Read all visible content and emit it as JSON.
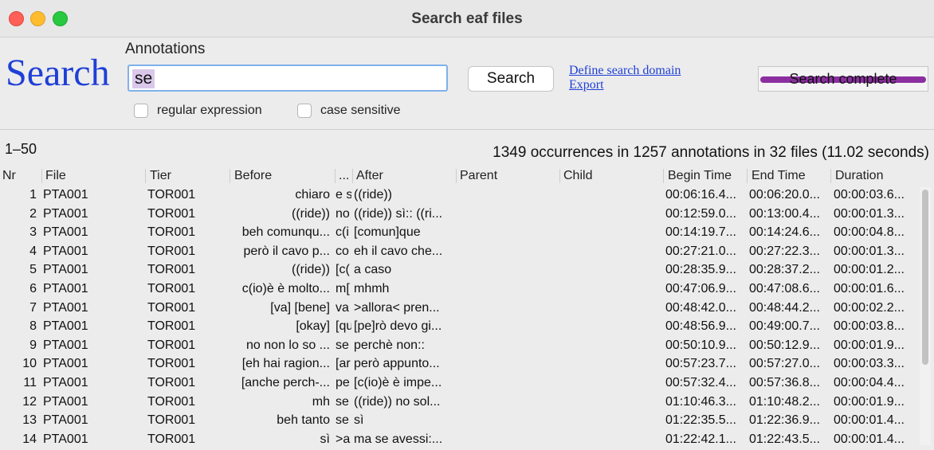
{
  "window": {
    "title": "Search eaf files"
  },
  "search": {
    "big_label": "Search",
    "annotations_label": "Annotations",
    "query": "se",
    "button_label": "Search",
    "define_domain_link": "Define search domain",
    "export_link": "Export",
    "status": "Search complete",
    "progress": 1.0,
    "regex_label": "regular expression",
    "regex_checked": false,
    "case_label": "case sensitive",
    "case_checked": false
  },
  "results": {
    "range": "1–50",
    "summary": "1349 occurrences in 1257 annotations in 32 files (11.02 seconds)",
    "columns": [
      "Nr",
      "File",
      "Tier",
      "Before",
      "...",
      "After",
      "Parent",
      "Child",
      "Begin Time",
      "End Time",
      "Duration"
    ],
    "rows": [
      {
        "nr": "1",
        "file": "PTA001",
        "tier": "TOR001",
        "before": "chiaro",
        "match": "e s",
        "after": "((ride))",
        "begin": "00:06:16.4...",
        "end": "00:06:20.0...",
        "dur": "00:00:03.6..."
      },
      {
        "nr": "2",
        "file": "PTA001",
        "tier": "TOR001",
        "before": "((ride))",
        "match": "no",
        "after": "((ride)) sì:: ((ri...",
        "begin": "00:12:59.0...",
        "end": "00:13:00.4...",
        "dur": "00:00:01.3..."
      },
      {
        "nr": "3",
        "file": "PTA001",
        "tier": "TOR001",
        "before": "beh comunqu...",
        "match": "c(i",
        "after": "[comun]que",
        "begin": "00:14:19.7...",
        "end": "00:14:24.6...",
        "dur": "00:00:04.8..."
      },
      {
        "nr": "4",
        "file": "PTA001",
        "tier": "TOR001",
        "before": "però il cavo p...",
        "match": "co",
        "after": "eh il cavo che...",
        "begin": "00:27:21.0...",
        "end": "00:27:22.3...",
        "dur": "00:00:01.3..."
      },
      {
        "nr": "5",
        "file": "PTA001",
        "tier": "TOR001",
        "before": "((ride))",
        "match": "[c(",
        "after": "a caso",
        "begin": "00:28:35.9...",
        "end": "00:28:37.2...",
        "dur": "00:00:01.2..."
      },
      {
        "nr": "6",
        "file": "PTA001",
        "tier": "TOR001",
        "before": "c(io)è è molto...",
        "match": "m[",
        "after": "mhmh",
        "begin": "00:47:06.9...",
        "end": "00:47:08.6...",
        "dur": "00:00:01.6..."
      },
      {
        "nr": "7",
        "file": "PTA001",
        "tier": "TOR001",
        "before": "[va] [bene]",
        "match": "va",
        "after": ">allora< pren...",
        "begin": "00:48:42.0...",
        "end": "00:48:44.2...",
        "dur": "00:00:02.2..."
      },
      {
        "nr": "8",
        "file": "PTA001",
        "tier": "TOR001",
        "before": "[okay]",
        "match": "[qu",
        "after": "[pe]rò devo gi...",
        "begin": "00:48:56.9...",
        "end": "00:49:00.7...",
        "dur": "00:00:03.8..."
      },
      {
        "nr": "9",
        "file": "PTA001",
        "tier": "TOR001",
        "before": "no non lo so ...",
        "match": "se",
        "after": "perchè non::",
        "begin": "00:50:10.9...",
        "end": "00:50:12.9...",
        "dur": "00:00:01.9..."
      },
      {
        "nr": "10",
        "file": "PTA001",
        "tier": "TOR001",
        "before": "[eh hai ragion...",
        "match": "[ar",
        "after": "però appunto...",
        "begin": "00:57:23.7...",
        "end": "00:57:27.0...",
        "dur": "00:00:03.3..."
      },
      {
        "nr": "11",
        "file": "PTA001",
        "tier": "TOR001",
        "before": "[anche perch-...",
        "match": "pe",
        "after": "[c(io)è è impe...",
        "begin": "00:57:32.4...",
        "end": "00:57:36.8...",
        "dur": "00:00:04.4..."
      },
      {
        "nr": "12",
        "file": "PTA001",
        "tier": "TOR001",
        "before": "mh",
        "match": "se",
        "after": "((ride)) no sol...",
        "begin": "01:10:46.3...",
        "end": "01:10:48.2...",
        "dur": "00:00:01.9..."
      },
      {
        "nr": "13",
        "file": "PTA001",
        "tier": "TOR001",
        "before": "beh tanto",
        "match": "se",
        "after": "sì",
        "begin": "01:22:35.5...",
        "end": "01:22:36.9...",
        "dur": "00:00:01.4..."
      },
      {
        "nr": "14",
        "file": "PTA001",
        "tier": "TOR001",
        "before": "sì",
        "match": ">a",
        "after": "ma se avessi:...",
        "begin": "01:22:42.1...",
        "end": "01:22:43.5...",
        "dur": "00:00:01.4..."
      }
    ]
  }
}
